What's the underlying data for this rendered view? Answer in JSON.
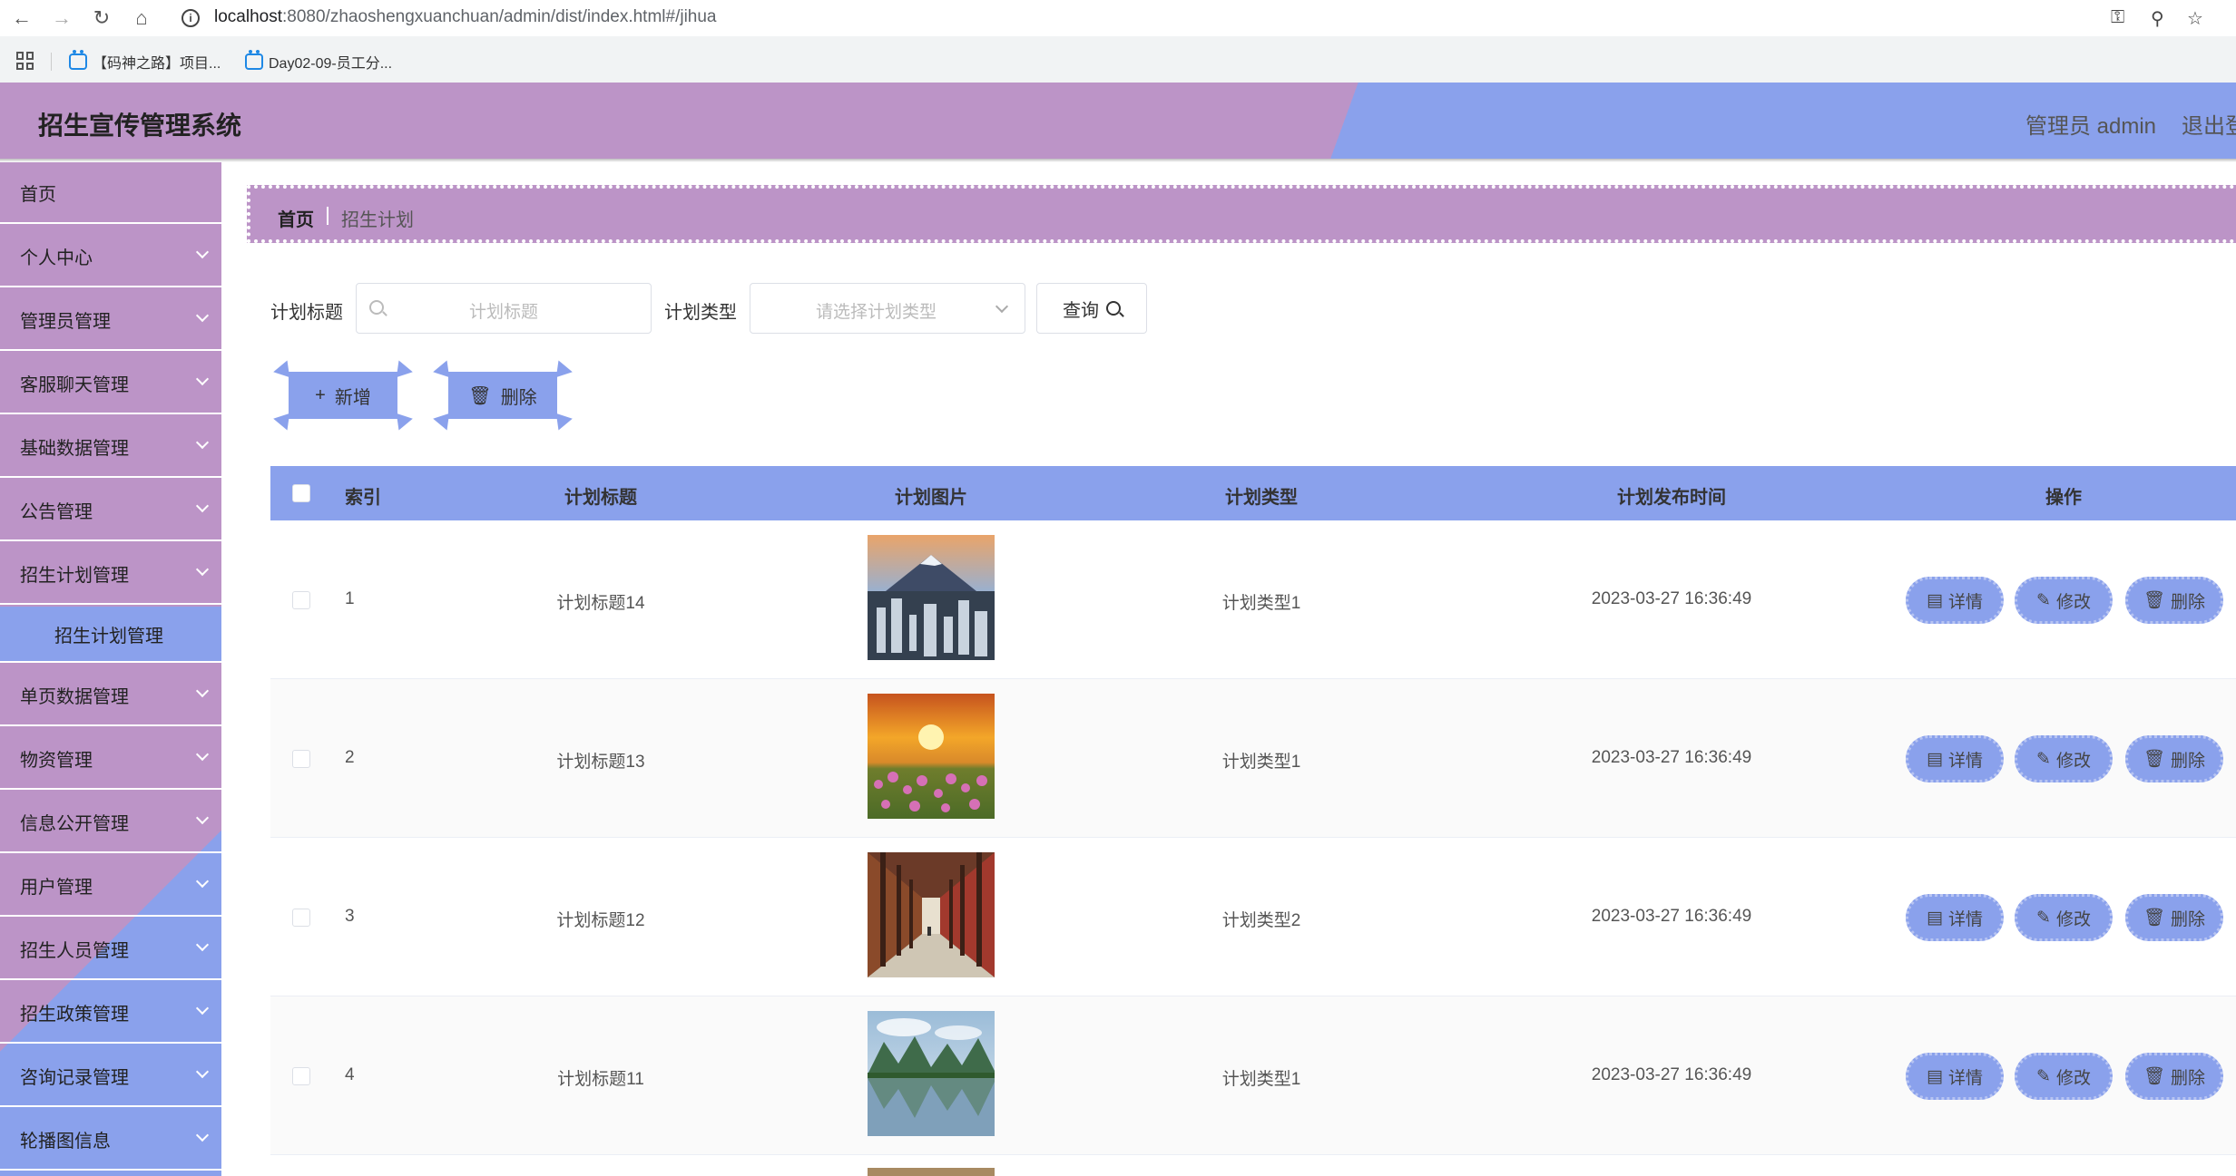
{
  "browser": {
    "url_host": "localhost",
    "url_rest": ":8080/zhaoshengxuanchuan/admin/dist/index.html#/jihua",
    "bookmarks": [
      "【码神之路】项目...",
      "Day02-09-员工分..."
    ]
  },
  "header": {
    "title": "招生宣传管理系统",
    "user": "管理员 admin",
    "logout": "退出登"
  },
  "sidebar": {
    "items": [
      {
        "label": "首页"
      },
      {
        "label": "个人中心"
      },
      {
        "label": "管理员管理"
      },
      {
        "label": "客服聊天管理"
      },
      {
        "label": "基础数据管理"
      },
      {
        "label": "公告管理"
      },
      {
        "label": "招生计划管理"
      },
      {
        "label": "单页数据管理"
      },
      {
        "label": "物资管理"
      },
      {
        "label": "信息公开管理"
      },
      {
        "label": "用户管理"
      },
      {
        "label": "招生人员管理"
      },
      {
        "label": "招生政策管理"
      },
      {
        "label": "咨询记录管理"
      },
      {
        "label": "轮播图信息"
      }
    ],
    "active_sub": "招生计划管理"
  },
  "breadcrumb": {
    "home": "首页",
    "current": "招生计划"
  },
  "search": {
    "title_label": "计划标题",
    "title_placeholder": "计划标题",
    "type_label": "计划类型",
    "type_placeholder": "请选择计划类型",
    "query_label": "查询"
  },
  "actions": {
    "add_label": "新增",
    "delete_label": "删除"
  },
  "table": {
    "headers": [
      "索引",
      "计划标题",
      "计划图片",
      "计划类型",
      "计划发布时间",
      "操作"
    ],
    "row_actions": {
      "detail": "详情",
      "edit": "修改",
      "delete": "删除"
    },
    "rows": [
      {
        "index": "1",
        "title": "计划标题14",
        "type": "计划类型1",
        "time": "2023-03-27 16:36:49",
        "image": "mountain-city"
      },
      {
        "index": "2",
        "title": "计划标题13",
        "type": "计划类型1",
        "time": "2023-03-27 16:36:49",
        "image": "sunset-flowers"
      },
      {
        "index": "3",
        "title": "计划标题12",
        "type": "计划类型2",
        "time": "2023-03-27 16:36:49",
        "image": "corridor"
      },
      {
        "index": "4",
        "title": "计划标题11",
        "type": "计划类型1",
        "time": "2023-03-27 16:36:49",
        "image": "lake-mountains"
      }
    ]
  },
  "colors": {
    "purple": "#bc94c7",
    "blue": "#8aa1ec"
  }
}
